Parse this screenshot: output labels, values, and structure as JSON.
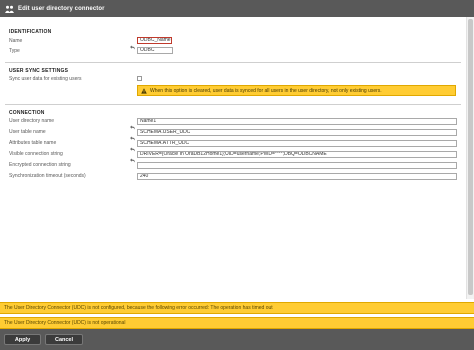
{
  "window": {
    "title": "Edit user directory connector"
  },
  "identification": {
    "heading": "IDENTIFICATION",
    "name_label": "Name",
    "name_value": "ODBC_Name1",
    "type_label": "Type",
    "type_value": "ODBC"
  },
  "user_sync": {
    "heading": "USER SYNC SETTINGS",
    "sync_label": "Sync user data for existing users",
    "sync_checked": false,
    "warning_text": "When this option is cleared, user data is synced for all users in the user directory, not only existing users."
  },
  "connection": {
    "heading": "CONNECTION",
    "dir_name_label": "User directory name",
    "dir_name_value": "Name1",
    "table_label": "User table name",
    "table_value": "SCHEMA.USER_UDC",
    "attr_label": "Attributes table name",
    "attr_value": "SCHEMA.ATTR_UDC",
    "conn_label": "Visible connection string",
    "conn_value": "DRIVER={Oracle In OraDB12Home1};UID=username;PWD=****;DBQ=ODBCNAME",
    "enc_label": "Encrypted connection string",
    "enc_value": "",
    "timeout_label": "Synchronization timeout (seconds)",
    "timeout_value": "240"
  },
  "errors": {
    "error1": "The User Directory Connector (UDC) is not configured, because the following error occurred: The operation has timed out",
    "error2": "The User Directory Connector (UDC) is not operational"
  },
  "footer": {
    "apply_label": "Apply",
    "cancel_label": "Cancel"
  },
  "colors": {
    "titlebar": "#595959",
    "warning": "#ffcc33",
    "invalid_border": "#c0392b"
  }
}
